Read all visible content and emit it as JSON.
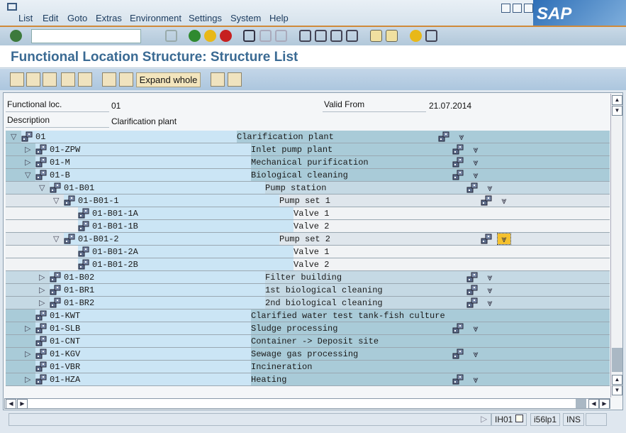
{
  "window": {
    "menu": [
      "List",
      "Edit",
      "Goto",
      "Extras",
      "Environment",
      "Settings",
      "System",
      "Help"
    ],
    "logo": "SAP"
  },
  "toolbar": {
    "command_placeholder": ""
  },
  "title": "Functional Location Structure: Structure List",
  "app_toolbar": {
    "expand_whole": "Expand whole"
  },
  "header": {
    "func_loc_label": "Functional loc.",
    "func_loc_value": "01",
    "valid_from_label": "Valid From",
    "valid_from_value": "21.07.2014",
    "description_label": "Description",
    "description_value": "Clarification plant"
  },
  "tree": [
    {
      "level": 0,
      "state": "open",
      "id": "01",
      "desc": "Clarification plant",
      "actions": true
    },
    {
      "level": 1,
      "state": "closed",
      "id": "01-ZPW",
      "desc": "Inlet pump plant",
      "actions": true
    },
    {
      "level": 1,
      "state": "closed",
      "id": "01-M",
      "desc": "Mechanical purification",
      "actions": true
    },
    {
      "level": 1,
      "state": "open",
      "id": "01-B",
      "desc": "Biological cleaning",
      "actions": true
    },
    {
      "level": 2,
      "state": "open",
      "id": "01-B01",
      "desc": "Pump station",
      "actions": true
    },
    {
      "level": 3,
      "state": "open",
      "id": "01-B01-1",
      "desc": "Pump set 1",
      "actions": true
    },
    {
      "level": 4,
      "state": "none",
      "id": "01-B01-1A",
      "desc": "Valve 1",
      "actions": false
    },
    {
      "level": 4,
      "state": "none",
      "id": "01-B01-1B",
      "desc": "Valve 2",
      "actions": false
    },
    {
      "level": 3,
      "state": "open",
      "id": "01-B01-2",
      "desc": "Pump set 2",
      "actions": true,
      "selected": true
    },
    {
      "level": 4,
      "state": "none",
      "id": "01-B01-2A",
      "desc": "Valve 1",
      "actions": false
    },
    {
      "level": 4,
      "state": "none",
      "id": "01-B01-2B",
      "desc": "Valve 2",
      "actions": false
    },
    {
      "level": 2,
      "state": "closed",
      "id": "01-B02",
      "desc": "Filter building",
      "actions": true
    },
    {
      "level": 2,
      "state": "closed",
      "id": "01-BR1",
      "desc": "1st biological cleaning",
      "actions": true
    },
    {
      "level": 2,
      "state": "closed",
      "id": "01-BR2",
      "desc": "2nd biological cleaning",
      "actions": true
    },
    {
      "level": 1,
      "state": "none",
      "id": "01-KWT",
      "desc": "Clarified water test tank-fish culture",
      "actions": false
    },
    {
      "level": 1,
      "state": "closed",
      "id": "01-SLB",
      "desc": "Sludge processing",
      "actions": true
    },
    {
      "level": 1,
      "state": "none",
      "id": "01-CNT",
      "desc": "Container -> Deposit site",
      "actions": false
    },
    {
      "level": 1,
      "state": "closed",
      "id": "01-KGV",
      "desc": "Sewage gas processing",
      "actions": true
    },
    {
      "level": 1,
      "state": "none",
      "id": "01-VBR",
      "desc": "Incineration",
      "actions": false
    },
    {
      "level": 1,
      "state": "closed",
      "id": "01-HZA",
      "desc": "Heating",
      "actions": true
    }
  ],
  "status": {
    "transaction": "IH01",
    "server": "i56lp1",
    "mode": "INS"
  },
  "colors": {
    "level0_1": "#a9cbd8",
    "level2": "#c5d9e4",
    "level3": "#dfe6ec",
    "level4": "#f1f3f5",
    "id_cell": "#cbe5f5",
    "selected": "#f5c12e"
  }
}
